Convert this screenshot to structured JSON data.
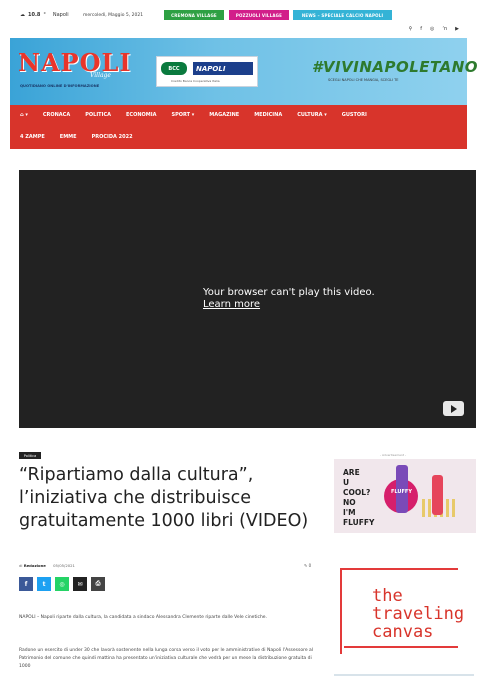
{
  "topbar": {
    "weather_temp": "10.8",
    "weather_unit": "°",
    "weather_city": "Napoli",
    "date": "mercoledì, Maggio 5, 2021",
    "pills": [
      "CREMONA VILLAGE",
      "POZZUOLI VILLAGE",
      "NEWS – SPECIALE CALCIO NAPOLI"
    ],
    "social_icons": [
      "search-icon",
      "facebook-icon",
      "instagram-icon",
      "rss-icon",
      "youtube-icon"
    ]
  },
  "header": {
    "logo_text": "NAPOLI",
    "logo_village": "Village",
    "logo_tagline": "QUOTIDIANO ONLINE D'INFORMAZIONE",
    "bcc_logo": "BCC",
    "bcc_name": "NAPOLI",
    "bcc_sub": "Credito Banca Cooperativa Italia",
    "hashtag": "#VIVINAPOLETANO",
    "hashtag_sub": "SCEGLI NAPOLI CHE MANGIA, SCEGLI TE"
  },
  "nav": {
    "row1": [
      "⌂ ▾",
      "CRONACA",
      "POLITICA",
      "ECONOMIA",
      "SPORT ▾",
      "MAGAZINE",
      "MEDICINA",
      "CULTURA ▾",
      "GUSTORI"
    ],
    "row2": [
      "4 ZAMPE",
      "EMME",
      "PROCIDA 2022"
    ]
  },
  "video": {
    "message": "Your browser can't play this video.",
    "link": "Learn more"
  },
  "article": {
    "category": "Politica",
    "title": "“Ripartiamo dalla cultura”, l’iniziativa che distribuisce gratuitamente 1000 libri (VIDEO)",
    "byline_prefix": "di",
    "author": "Redazione",
    "date": "05/05/2021",
    "comments": "0",
    "share_buttons": [
      {
        "icon": "facebook-icon",
        "glyph": "f"
      },
      {
        "icon": "twitter-icon",
        "glyph": "t"
      },
      {
        "icon": "whatsapp-icon",
        "glyph": "◎"
      },
      {
        "icon": "email-icon",
        "glyph": "✉"
      },
      {
        "icon": "print-icon",
        "glyph": "⎙"
      }
    ],
    "paragraph1": "NAPOLI – Napoli riparte dalla cultura, la candidata a sindaco Alessandra Clemente riparte dalle Vele cinetiche.",
    "paragraph2": "Radone un esercito di under 30 che lavorà sostenente nella lunga corsa verso il voto per le amministrative di Napoli l'Assessore al Patrimonio del comune che quindi mattina ha presentato un'iniziativa culturale che vedrà per un mese la distribuzione gratuita di 1000"
  },
  "sidebar": {
    "ad_label": "- Advertisement -",
    "ad1_text": [
      "ARE",
      "U",
      "COOL?",
      "NO",
      "I'M",
      "FLUFFY"
    ],
    "ad1_product": "FLUFFY",
    "ad2_text": [
      "the",
      "traveling",
      "canvas"
    ]
  },
  "colors": {
    "nav_red": "#d8342b",
    "header_blue": "#3aa3d7",
    "video_bg": "#222222",
    "pill_green": "#2ea043",
    "pill_pink": "#d21f8a",
    "pill_cyan": "#34b3d6"
  }
}
